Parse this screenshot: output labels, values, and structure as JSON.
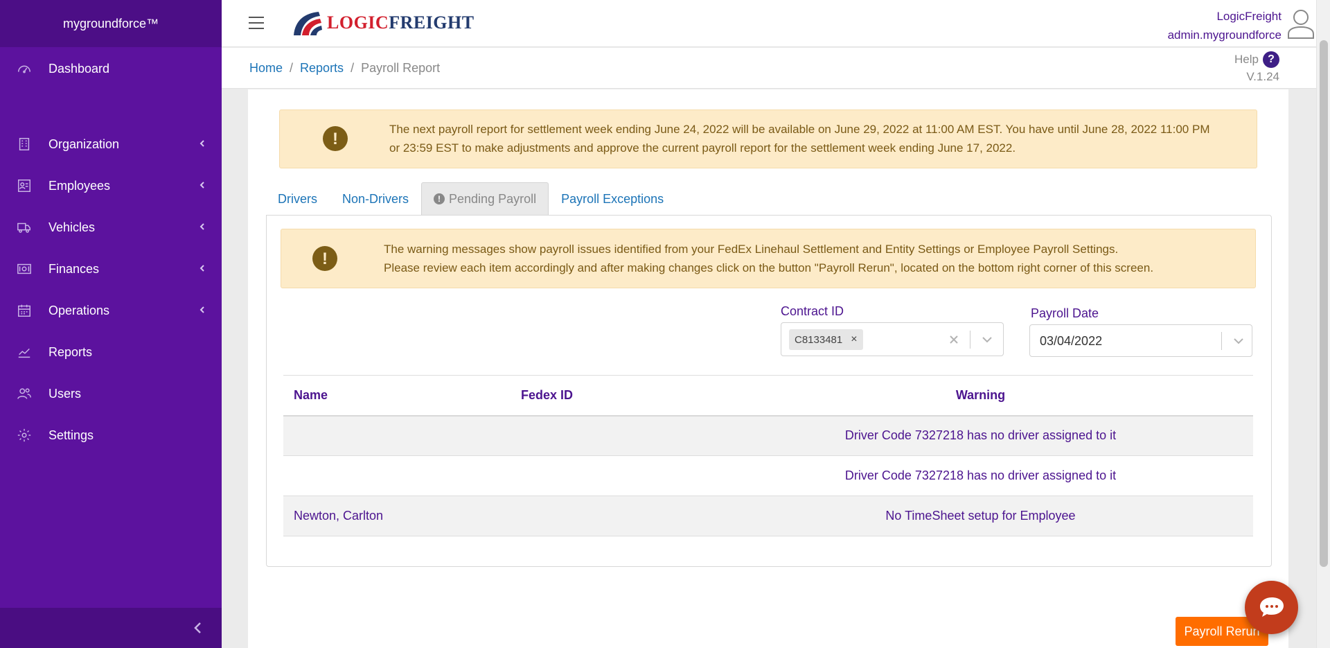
{
  "app": {
    "brand": "mygroundforce™"
  },
  "sidebar": {
    "items": [
      {
        "label": "Dashboard"
      },
      {
        "label": "Organization"
      },
      {
        "label": "Employees"
      },
      {
        "label": "Vehicles"
      },
      {
        "label": "Finances"
      },
      {
        "label": "Operations"
      },
      {
        "label": "Reports"
      },
      {
        "label": "Users"
      },
      {
        "label": "Settings"
      }
    ]
  },
  "header": {
    "logo_part1": "LOGIC",
    "logo_part2": "FREIGHT",
    "company": "LogicFreight",
    "username": "admin.mygroundforce"
  },
  "breadcrumb": {
    "home": "Home",
    "sep": "/",
    "reports": "Reports",
    "current": "Payroll Report"
  },
  "help": {
    "label": "Help",
    "icon": "?",
    "version": "V.1.24"
  },
  "notice": {
    "line1": "The next payroll report for settlement week ending June 24, 2022 will be available on June 29, 2022 at 11:00 AM EST. You have until June 28, 2022 11:00 PM",
    "line2": "or 23:59 EST to make adjustments and approve the current payroll report for the settlement week ending June 17, 2022.",
    "icon": "!"
  },
  "tabs": [
    {
      "label": "Drivers"
    },
    {
      "label": "Non-Drivers"
    },
    {
      "label": "Pending Payroll"
    },
    {
      "label": "Payroll Exceptions"
    }
  ],
  "warning": {
    "line1": "The warning messages show payroll issues identified from your FedEx Linehaul Settlement and Entity Settings or Employee Payroll Settings.",
    "line2": "Please review each item accordingly and after making changes click on the button \"Payroll Rerun\", located on the bottom right corner of this screen.",
    "icon": "!"
  },
  "filters": {
    "contract_label": "Contract ID",
    "contract_value": "C8133481",
    "chip_remove": "×",
    "payroll_date_label": "Payroll Date",
    "payroll_date_value": "03/04/2022"
  },
  "table": {
    "headers": [
      "Name",
      "Fedex ID",
      "Warning"
    ],
    "rows": [
      {
        "name": "",
        "fedex_id": "",
        "warning": "Driver Code 7327218 has no driver assigned to it"
      },
      {
        "name": "",
        "fedex_id": "",
        "warning": "Driver Code 7327218 has no driver assigned to it"
      },
      {
        "name": "Newton, Carlton",
        "fedex_id": "",
        "warning": "No TimeSheet setup for Employee"
      }
    ]
  },
  "actions": {
    "rerun_label": "Payroll Rerun"
  },
  "colors": {
    "sidebar": "#5c129e",
    "accent_text": "#4c148f",
    "link": "#1c74b7",
    "alert_bg": "#fdebc8",
    "button": "#ff6d00"
  }
}
